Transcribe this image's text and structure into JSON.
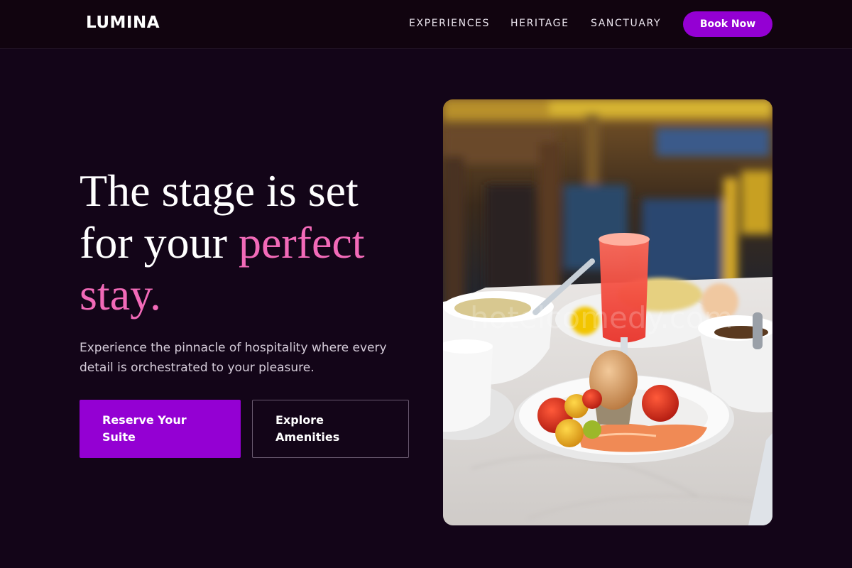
{
  "brand": {
    "name": "LUMINA"
  },
  "nav": {
    "links": [
      "EXPERIENCES",
      "HERITAGE",
      "SANCTUARY"
    ],
    "cta_label": "Book Now"
  },
  "hero": {
    "headline_part1": "The stage is set for your ",
    "headline_accent": "perfect stay.",
    "subtext": "Experience the pinnacle of hospitality where every detail is orchestrated to your pleasure.",
    "primary_button": "Reserve Your Suite",
    "secondary_button": "Explore Amenities",
    "image_watermark": "hotelcomedy.com"
  },
  "colors": {
    "background": "#130518",
    "accent_purple": "#9400d3",
    "accent_pink": "#f26ab8"
  }
}
